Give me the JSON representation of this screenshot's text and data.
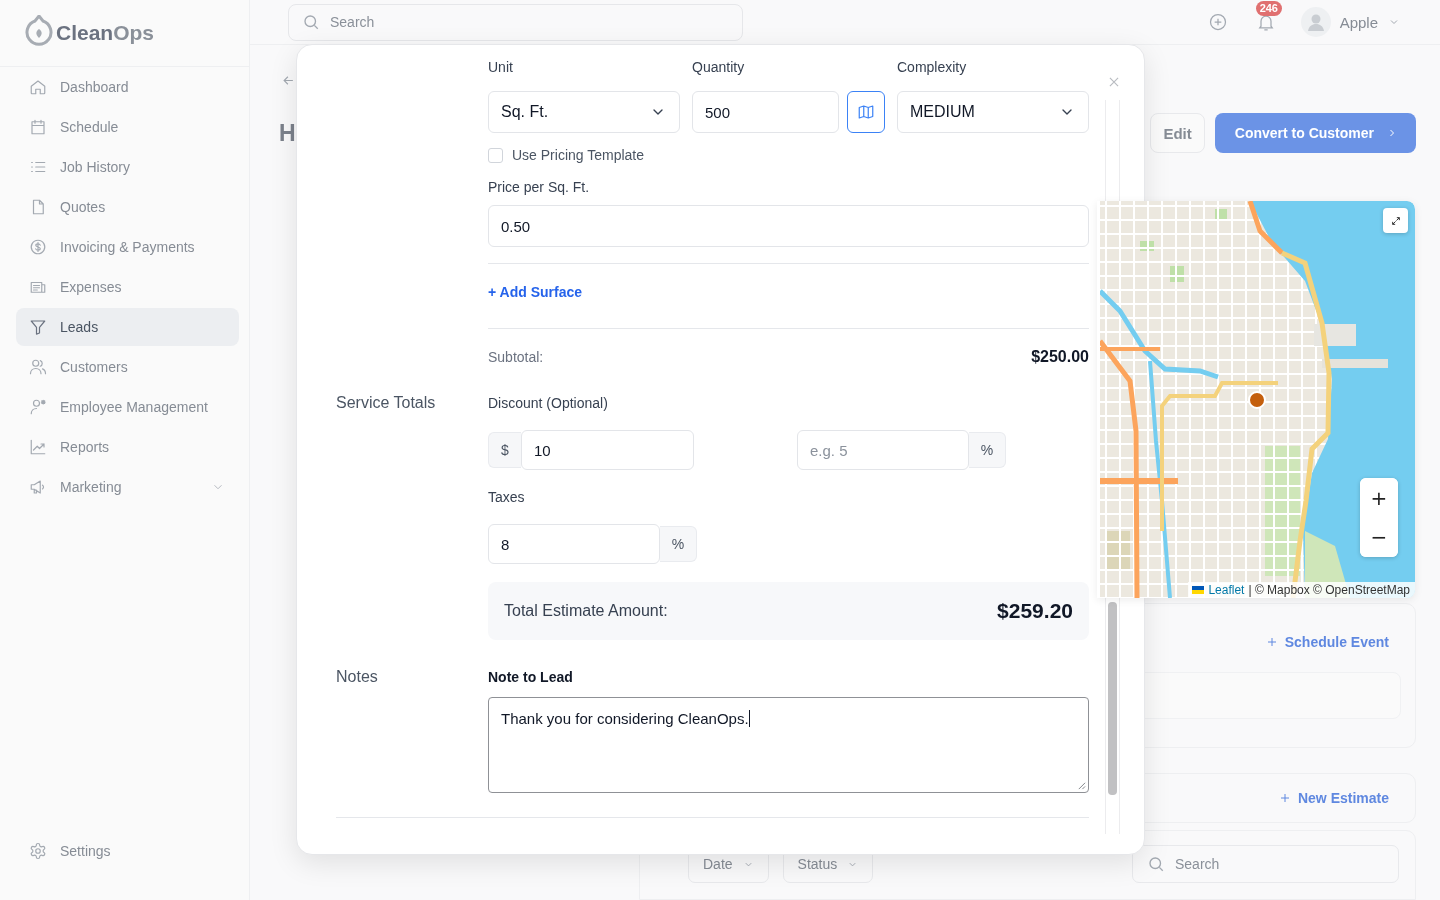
{
  "sidebar": {
    "logo": {
      "primary": "Clean",
      "secondary": "Ops"
    },
    "items": [
      {
        "label": "Dashboard",
        "kind": "link",
        "selected": false
      },
      {
        "label": "Schedule",
        "kind": "link",
        "selected": false
      },
      {
        "label": "Job History",
        "kind": "link",
        "selected": false
      },
      {
        "label": "Quotes",
        "kind": "link",
        "selected": false
      },
      {
        "label": "Invoicing & Payments",
        "kind": "link",
        "selected": false
      },
      {
        "label": "Expenses",
        "kind": "link",
        "selected": false
      },
      {
        "label": "Leads",
        "kind": "link",
        "selected": true
      },
      {
        "label": "Customers",
        "kind": "link",
        "selected": false
      },
      {
        "label": "Employee Management",
        "kind": "link",
        "selected": false
      },
      {
        "label": "Reports",
        "kind": "link",
        "selected": false
      },
      {
        "label": "Marketing",
        "kind": "group",
        "selected": false
      }
    ],
    "footer_item": {
      "label": "Settings"
    }
  },
  "header": {
    "search": {
      "placeholder": "Search"
    },
    "notifications": {
      "count": "246"
    },
    "user": {
      "name": "Apple"
    }
  },
  "lead_page": {
    "title": "H",
    "buttons": [
      {
        "label": "Edit",
        "kind": "secondary"
      },
      {
        "label": "Convert to Customer",
        "kind": "primary"
      }
    ],
    "schedule_card": {
      "action": "Schedule Event"
    },
    "estimates_card": {
      "action": "New Estimate"
    },
    "filters": [
      {
        "label": "Date"
      },
      {
        "label": "Status"
      }
    ],
    "search": {
      "placeholder": "Search"
    }
  },
  "modal": {
    "surface": {
      "unit": {
        "label": "Unit",
        "value": "Sq. Ft."
      },
      "quantity": {
        "label": "Quantity",
        "value": "500"
      },
      "complexity": {
        "label": "Complexity",
        "value": "MEDIUM"
      },
      "use_pricing_template": {
        "label": "Use Pricing Template",
        "checked": false
      },
      "price": {
        "label": "Price per Sq. Ft.",
        "value": "0.50"
      }
    },
    "add_surface": "+ Add Surface",
    "service_totals": {
      "heading": "Service Totals",
      "subtotal": {
        "label": "Subtotal:",
        "value": "$250.00"
      },
      "discount": {
        "label": "Discount (Optional)",
        "amount": {
          "prefix": "$",
          "value": "10"
        },
        "percent": {
          "placeholder": "e.g. 5",
          "suffix": "%"
        }
      },
      "taxes": {
        "label": "Taxes",
        "value": "8",
        "suffix": "%"
      },
      "total": {
        "label": "Total Estimate Amount:",
        "value": "$259.20"
      }
    },
    "notes": {
      "heading": "Notes",
      "label": "Note to Lead",
      "value": "Thank you for considering CleanOps."
    }
  },
  "map": {
    "zoom_in": "+",
    "zoom_out": "−",
    "attribution": {
      "link": "Leaflet",
      "text": "| © Mapbox © OpenStreetMap"
    }
  }
}
